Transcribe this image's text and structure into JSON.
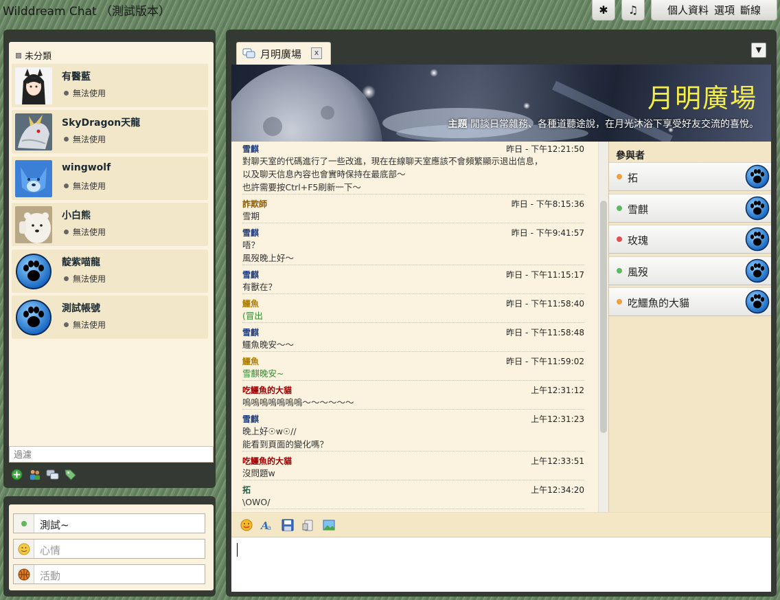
{
  "app": {
    "title": "Wilddream Chat （測試版本）"
  },
  "topbar": {
    "asterisk_icon": "asterisk-icon",
    "music_icon": "music-note-icon",
    "menu": [
      "個人資料",
      "選項",
      "斷線"
    ]
  },
  "contacts": {
    "category": "未分類",
    "items": [
      {
        "name": "有醫藍",
        "status": "無法使用",
        "avatar": "anime-girl-avatar"
      },
      {
        "name": "SkyDragon天龍",
        "status": "無法使用",
        "avatar": "dragon-avatar"
      },
      {
        "name": "wingwolf",
        "status": "無法使用",
        "avatar": "blue-wolf-avatar"
      },
      {
        "name": "小白熊",
        "status": "無法使用",
        "avatar": "polar-bear-avatar"
      },
      {
        "name": "靛紫喵龍",
        "status": "無法使用",
        "avatar": "paw-avatar"
      },
      {
        "name": "測試帳號",
        "status": "無法使用",
        "avatar": "paw-avatar"
      }
    ],
    "filter_placeholder": "過濾"
  },
  "status_panel": {
    "status_value": "測試~",
    "mood_placeholder": "心情",
    "activity_placeholder": "活動"
  },
  "room": {
    "tab_label": "月明廣場",
    "tab_close": "x",
    "dropdown": "▼",
    "banner_title": "月明廣場",
    "banner_topic_label": "主題",
    "banner_topic": "閒談日常雜務、各種道聽途說，在月光沐浴下享受好友交流的喜悅。",
    "messages": [
      {
        "sender": "雪麒",
        "color": "#1f3a7a",
        "time": "昨日 - 下午12:21:50",
        "lines": [
          "對聊天室的代碼進行了一些改進，現在在線聊天室應該不會頻繁顯示退出信息，",
          "以及聊天信息內容也會實時保持在最底部～",
          "也許需要按Ctrl+F5刷新一下～"
        ],
        "text_color": "#333"
      },
      {
        "sender": "詐欺師",
        "color": "#8a5a00",
        "time": "昨日 - 下午8:15:36",
        "lines": [
          "雪期"
        ],
        "text_color": "#333"
      },
      {
        "sender": "雪麒",
        "color": "#1f3a7a",
        "time": "昨日 - 下午9:41:57",
        "lines": [
          "唔？",
          "風歿晚上好～"
        ],
        "text_color": "#333"
      },
      {
        "sender": "雪麒",
        "color": "#1f3a7a",
        "time": "昨日 - 下午11:15:17",
        "lines": [
          "有獸在？"
        ],
        "text_color": "#333"
      },
      {
        "sender": "鱷魚",
        "color": "#b07d00",
        "time": "昨日 - 下午11:58:40",
        "lines": [
          "(冒出"
        ],
        "text_color": "#2e8b2e"
      },
      {
        "sender": "雪麒",
        "color": "#1f3a7a",
        "time": "昨日 - 下午11:58:48",
        "lines": [
          "鱷魚晚安～～"
        ],
        "text_color": "#333"
      },
      {
        "sender": "鱷魚",
        "color": "#b07d00",
        "time": "昨日 - 下午11:59:02",
        "lines": [
          "雪麒晚安~"
        ],
        "text_color": "#2e8b2e"
      },
      {
        "sender": "吃鱷魚的大貓",
        "color": "#a00000",
        "time": "上午12:31:12",
        "lines": [
          "嗚嗚嗚嗚嗚嗚嗚～～～～～～"
        ],
        "text_color": "#333"
      },
      {
        "sender": "雪麒",
        "color": "#1f3a7a",
        "time": "上午12:31:23",
        "lines": [
          "晚上好☉w☉//",
          "能看到頁面的變化嗎？"
        ],
        "text_color": "#333"
      },
      {
        "sender": "吃鱷魚的大貓",
        "color": "#a00000",
        "time": "上午12:33:51",
        "lines": [
          "沒問題w"
        ],
        "text_color": "#333"
      },
      {
        "sender": "拓",
        "color": "#1b5e4a",
        "time": "上午12:34:20",
        "lines": [
          "\\OWO/"
        ],
        "text_color": "#333"
      }
    ],
    "participants_header": "參與者",
    "participants": [
      {
        "name": "拓",
        "status_color": "#f0a040"
      },
      {
        "name": "雪麒",
        "status_color": "#5fb85f"
      },
      {
        "name": "玫瑰",
        "status_color": "#e05050"
      },
      {
        "name": "風歿",
        "status_color": "#5fb85f"
      },
      {
        "name": "吃鱷魚的大貓",
        "status_color": "#f0a040"
      }
    ]
  },
  "toolbar_icons": [
    "emoticon-icon",
    "font-style-icon",
    "save-icon",
    "clear-icon",
    "image-icon"
  ]
}
